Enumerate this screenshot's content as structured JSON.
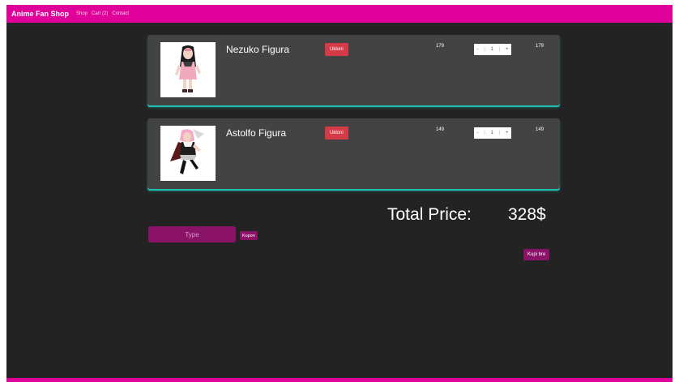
{
  "nav": {
    "brand": "Anime Fan Shop",
    "links": [
      "Shop",
      "Cart (2)",
      "Contact"
    ]
  },
  "cart": {
    "items": [
      {
        "name": "Nezuko Figura",
        "remove_label": "Ukloni",
        "unit_price": "179",
        "quantity": "1",
        "line_total": "179"
      },
      {
        "name": "Astolfo Figura",
        "remove_label": "Ukloni",
        "unit_price": "149",
        "quantity": "1",
        "line_total": "149"
      }
    ],
    "stepper": {
      "minus": "-",
      "plus": "+"
    }
  },
  "summary": {
    "total_label": "Total Price:",
    "total_value": "328$"
  },
  "coupon": {
    "placeholder": "Type",
    "button_label": "Kupon"
  },
  "checkout": {
    "button_label": "Kupi bre"
  },
  "colors": {
    "accent": "#e0009a",
    "card": "#434343",
    "card_glow": "#1ebfb4",
    "remove": "#d43b47",
    "purple_button": "#8a1368"
  }
}
